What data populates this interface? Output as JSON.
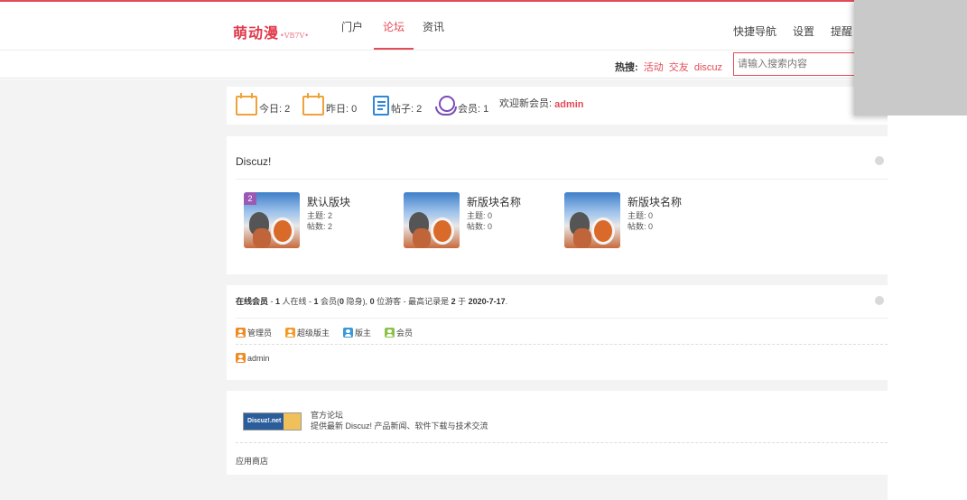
{
  "header": {
    "logo": "萌动漫",
    "logo_tag": "•VB7Ⅴ•",
    "nav": [
      "门户",
      "论坛",
      "资讯"
    ],
    "active_nav": "论坛",
    "right_links": [
      "快捷导航",
      "设置",
      "提醒"
    ]
  },
  "search": {
    "hot_label": "热搜:",
    "hot_links": [
      "活动",
      "交友",
      "discuz"
    ],
    "placeholder": "请输入搜索内容"
  },
  "stats": {
    "today": "今日: 2",
    "yesterday": "昨日: 0",
    "posts": "帖子: 2",
    "members": "会员: 1",
    "welcome_label": "欢迎新会员:",
    "welcome_name": "admin"
  },
  "forum": {
    "title": "Discuz!",
    "boards": [
      {
        "name": "默认版块",
        "topics": "主题: 2",
        "posts": "帖数: 2",
        "badge": "2"
      },
      {
        "name": "新版块名称",
        "topics": "主题: 0",
        "posts": "帖数: 0",
        "badge": ""
      },
      {
        "name": "新版块名称",
        "topics": "主题: 0",
        "posts": "帖数: 0",
        "badge": ""
      }
    ]
  },
  "online": {
    "label": "在线会员",
    "sep1": " - ",
    "count_online": "1",
    "text1": " 人在线 - ",
    "count_members": "1",
    "text2": " 会员(",
    "count_hidden": "0",
    "text3": " 隐身), ",
    "count_guests": "0",
    "text4": " 位游客 - 最高记录是 ",
    "record": "2",
    "text5": " 于 ",
    "record_date": "2020-7-17",
    "end": ".",
    "legend": [
      {
        "label": "管理员",
        "color": "#f08a24"
      },
      {
        "label": "超级版主",
        "color": "#f39c2c"
      },
      {
        "label": "版主",
        "color": "#3a9ad9"
      },
      {
        "label": "会员",
        "color": "#8bc34a"
      }
    ],
    "user": "admin"
  },
  "links": {
    "logo_text": "Discuz!.net",
    "name": "官方论坛",
    "desc": "提供最新 Discuz! 产品新闻、软件下载与技术交流",
    "appstore": "应用商店"
  }
}
